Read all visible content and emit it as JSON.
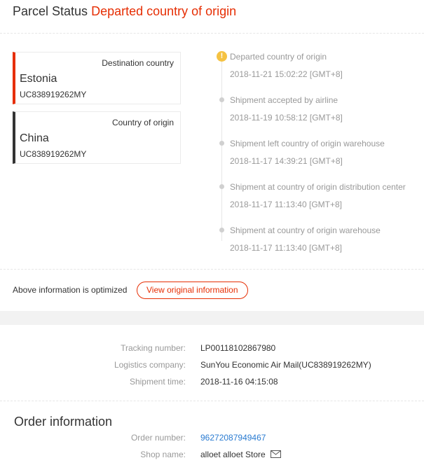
{
  "header": {
    "title": "Parcel Status",
    "status": "Departed country of origin"
  },
  "destination_card": {
    "label": "Destination country",
    "country": "Estonia",
    "tracking_code": "UC838919262MY"
  },
  "origin_card": {
    "label": "Country of origin",
    "country": "China",
    "tracking_code": "UC838919262MY"
  },
  "timeline": [
    {
      "title": "Departed country of origin",
      "time": "2018-11-21 15:02:22 [GMT+8]",
      "current": true
    },
    {
      "title": "Shipment accepted by airline",
      "time": "2018-11-19 10:58:12 [GMT+8]",
      "current": false
    },
    {
      "title": "Shipment left country of origin warehouse",
      "time": "2018-11-17 14:39:21 [GMT+8]",
      "current": false
    },
    {
      "title": "Shipment at country of origin distribution center",
      "time": "2018-11-17 11:13:40 [GMT+8]",
      "current": false
    },
    {
      "title": "Shipment at country of origin warehouse",
      "time": "2018-11-17 11:13:40 [GMT+8]",
      "current": false
    }
  ],
  "current_marker": "!",
  "optimized": {
    "text": "Above information is optimized",
    "button_label": "View original information"
  },
  "shipping_info": {
    "tracking_label": "Tracking number:",
    "tracking_value": "LP00118102867980",
    "company_label": "Logistics company:",
    "company_value": "SunYou Economic Air Mail(UC838919262MY)",
    "shipment_time_label": "Shipment time:",
    "shipment_time_value": "2018-11-16 04:15:08"
  },
  "order": {
    "title": "Order information",
    "order_number_label": "Order number:",
    "order_number_value": "96272087949467",
    "shop_name_label": "Shop name:",
    "shop_name_value": "alloet alloet Store"
  },
  "icons": {
    "mail": "mail-icon",
    "current_status": "exclamation-icon"
  },
  "colors": {
    "accent_red": "#e62e04",
    "current_yellow": "#f5c242",
    "link_blue": "#2a7bd1",
    "muted_gray": "#999999"
  }
}
